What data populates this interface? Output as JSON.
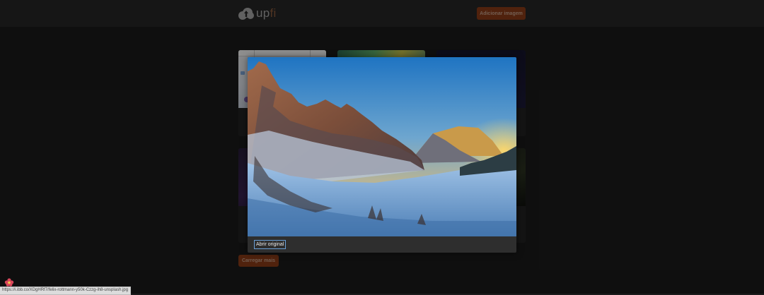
{
  "header": {
    "logo_text_main": "up",
    "logo_text_accent": "fi",
    "add_button_label": "Adicionar imagem"
  },
  "gallery": {
    "load_more_label": "Carregar mais"
  },
  "modal": {
    "open_original_label": "Abrir original"
  },
  "status_bar": {
    "url": "https://i.ibb.co/XDgHRf7/felix-rottmann-y50k-Czzg-ih8-unsplash.jpg"
  },
  "colors": {
    "accent": "#8a3c17",
    "background": "#1b1b1b",
    "header": "#262626",
    "modal": "#2e2e2e"
  }
}
